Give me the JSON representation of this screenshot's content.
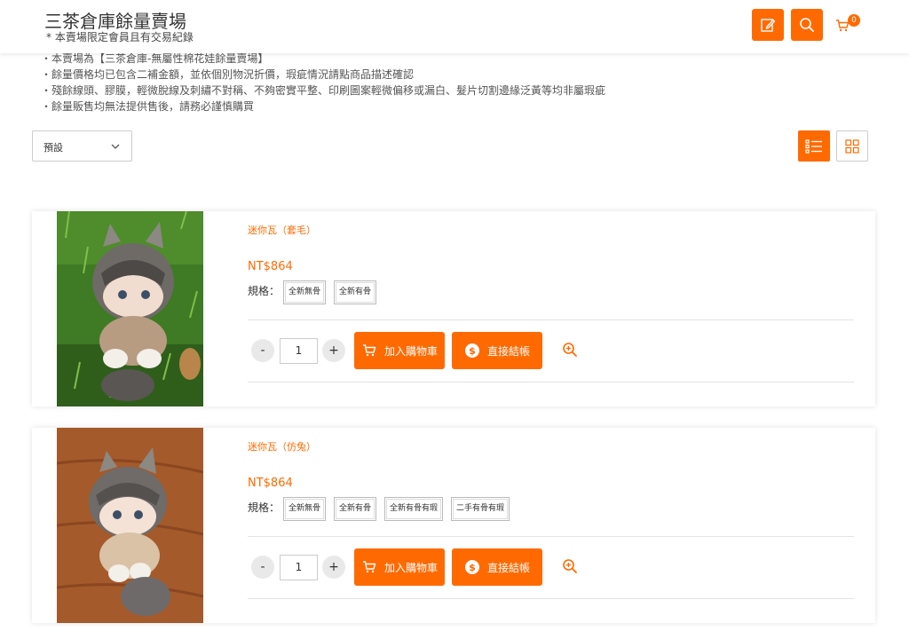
{
  "header": {
    "title": "三茶倉庫餘量賣場",
    "subtitle": "* 本賣場限定會員且有交易紀錄",
    "cart_count": "0"
  },
  "notices": [
    "本賣場為【三茶倉庫-無屬性棉花娃餘量賣場】",
    "餘量價格均已包含二補金額，並依個別物況折價，瑕疵情況請點商品描述確認",
    "殘餘線頭、膠膜，輕微脫線及刺繡不對稱、不夠密實平整、印刷圖案輕微偏移或漏白、髮片切割邊緣泛黃等均非屬瑕疵",
    "餘量販售均無法提供售後，請務必謹慎購買"
  ],
  "sort": {
    "selected": "預設"
  },
  "products": [
    {
      "name": "迷你瓦（套毛）",
      "price": "NT$864",
      "spec_label": "規格：",
      "specs": [
        "全新無骨",
        "全新有骨"
      ],
      "qty": "1",
      "add_cart_label": "加入購物車",
      "checkout_label": "直接結帳"
    },
    {
      "name": "迷你瓦（仿兔）",
      "price": "NT$864",
      "spec_label": "規格：",
      "specs": [
        "全新無骨",
        "全新有骨",
        "全新有骨有瑕",
        "二手有骨有瑕"
      ],
      "qty": "1",
      "add_cart_label": "加入購物車",
      "checkout_label": "直接結帳"
    }
  ],
  "colors": {
    "accent": "#ff6a00"
  },
  "icons": [
    "edit-icon",
    "search-icon",
    "cart-icon",
    "chevron-down-icon",
    "list-view-icon",
    "grid-view-icon",
    "zoom-in-icon",
    "dollar-icon"
  ]
}
